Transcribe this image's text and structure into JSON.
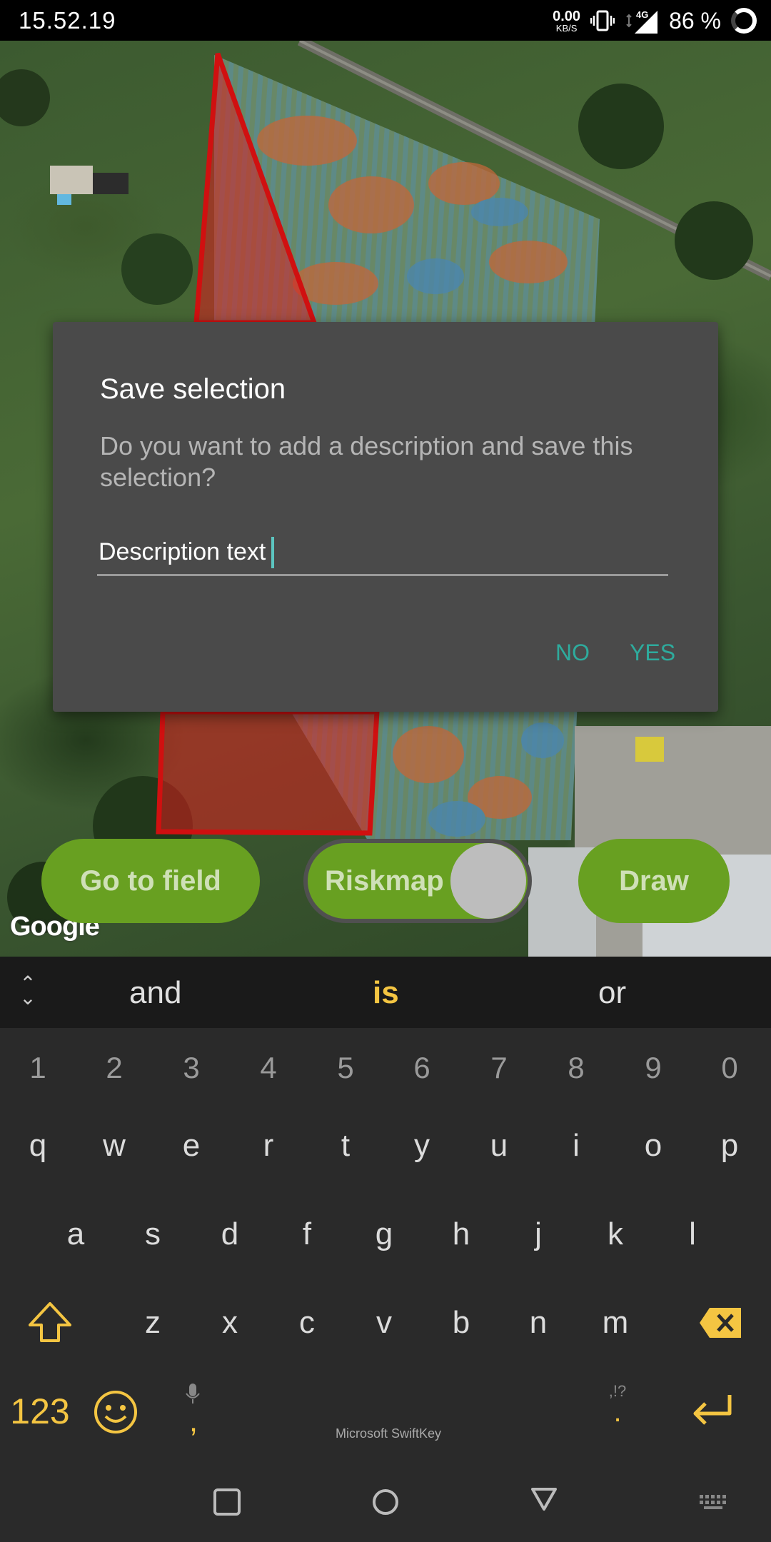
{
  "status_bar": {
    "time": "15.52.19",
    "net_speed_value": "0.00",
    "net_speed_unit": "KB/S",
    "network_type": "4G",
    "battery": "86 %"
  },
  "map": {
    "attribution": "Google",
    "buttons": {
      "go_to_field": "Go to field",
      "riskmap": "Riskmap",
      "draw": "Draw"
    },
    "riskmap_toggle_on": true
  },
  "dialog": {
    "title": "Save selection",
    "message": "Do you want to add a description and save this selection?",
    "input_value": "Description text",
    "no_label": "NO",
    "yes_label": "YES"
  },
  "keyboard": {
    "suggestions": [
      "and",
      "is",
      "or"
    ],
    "number_row": [
      "1",
      "2",
      "3",
      "4",
      "5",
      "6",
      "7",
      "8",
      "9",
      "0"
    ],
    "row1": [
      "q",
      "w",
      "e",
      "r",
      "t",
      "y",
      "u",
      "i",
      "o",
      "p"
    ],
    "row2": [
      "a",
      "s",
      "d",
      "f",
      "g",
      "h",
      "j",
      "k",
      "l"
    ],
    "row3": [
      "z",
      "x",
      "c",
      "v",
      "b",
      "n",
      "m"
    ],
    "numbers_key": "123",
    "comma_key": ",",
    "period_key": ".",
    "punct_hint": ",!?",
    "brand": "Microsoft SwiftKey"
  },
  "colors": {
    "accent_green": "#68a021",
    "dialog_bg": "#4a4a4a",
    "dialog_button": "#2eab9d",
    "keyboard_accent": "#f4c542",
    "selection_red": "#d01010"
  }
}
